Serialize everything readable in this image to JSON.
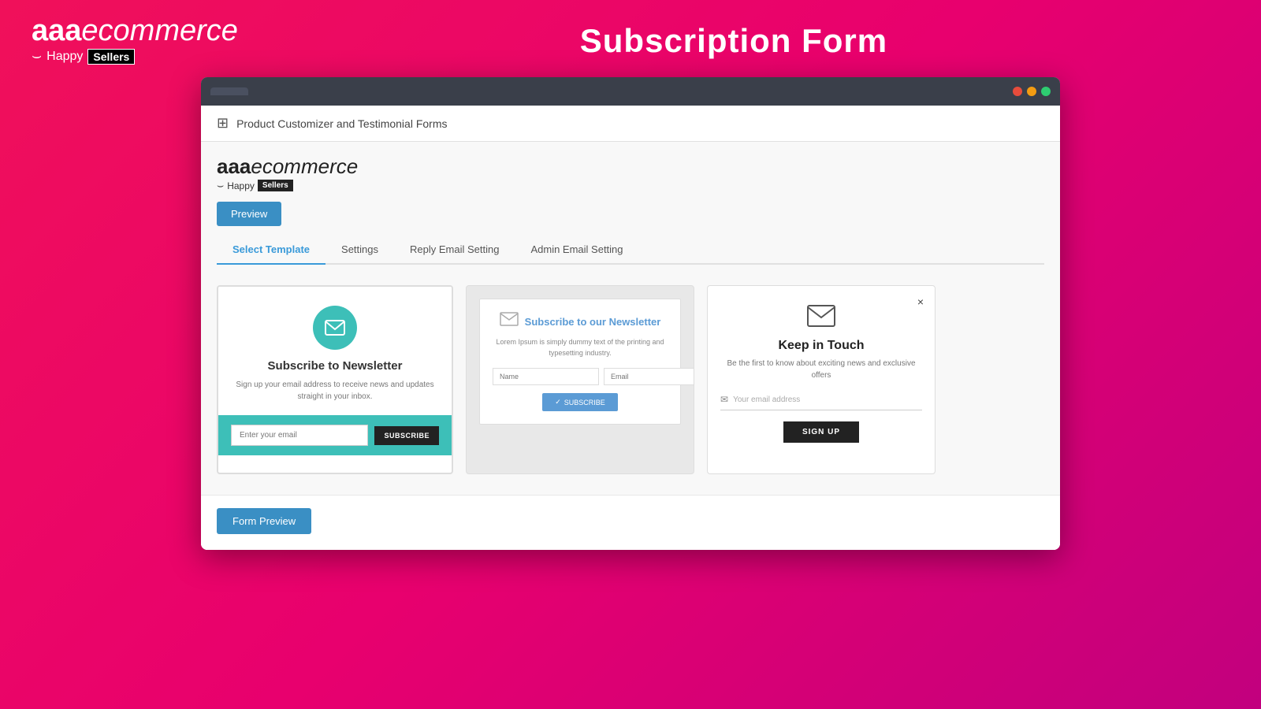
{
  "header": {
    "logo": {
      "brand": "aaa",
      "ecommerce": "ecommerce",
      "tagline_happy": "Happy",
      "tagline_sellers": "Sellers"
    },
    "page_title": "Subscription Form"
  },
  "browser": {
    "tab_label": "",
    "dots": [
      "red",
      "yellow",
      "green"
    ]
  },
  "app": {
    "breadcrumb": "Product Customizer and Testimonial Forms",
    "logo": {
      "brand": "aaa",
      "ecommerce": "ecommerce",
      "happy": "Happy",
      "sellers": "Sellers"
    },
    "preview_button": "Preview",
    "tabs": [
      {
        "label": "Select Template",
        "active": true
      },
      {
        "label": "Settings",
        "active": false
      },
      {
        "label": "Reply Email Setting",
        "active": false
      },
      {
        "label": "Admin Email Setting",
        "active": false
      }
    ],
    "templates": [
      {
        "id": 1,
        "title": "Subscribe to Newsletter",
        "description": "Sign up your email address to receive news and updates straight in your inbox.",
        "input_placeholder": "Enter your email",
        "button_label": "SUBSCRIBE"
      },
      {
        "id": 2,
        "title": "Subscribe to our Newsletter",
        "description": "Lorem Ipsum is simply dummy text of the printing and typesetting industry.",
        "name_placeholder": "Name",
        "email_placeholder": "Email",
        "button_label": "SUBSCRIBE"
      },
      {
        "id": 3,
        "title": "Keep in Touch",
        "description": "Be the first to know about exciting news and exclusive offers",
        "email_placeholder": "Your email address",
        "button_label": "SIGN UP",
        "close_icon": "×"
      }
    ],
    "form_preview_button": "Form Preview"
  }
}
